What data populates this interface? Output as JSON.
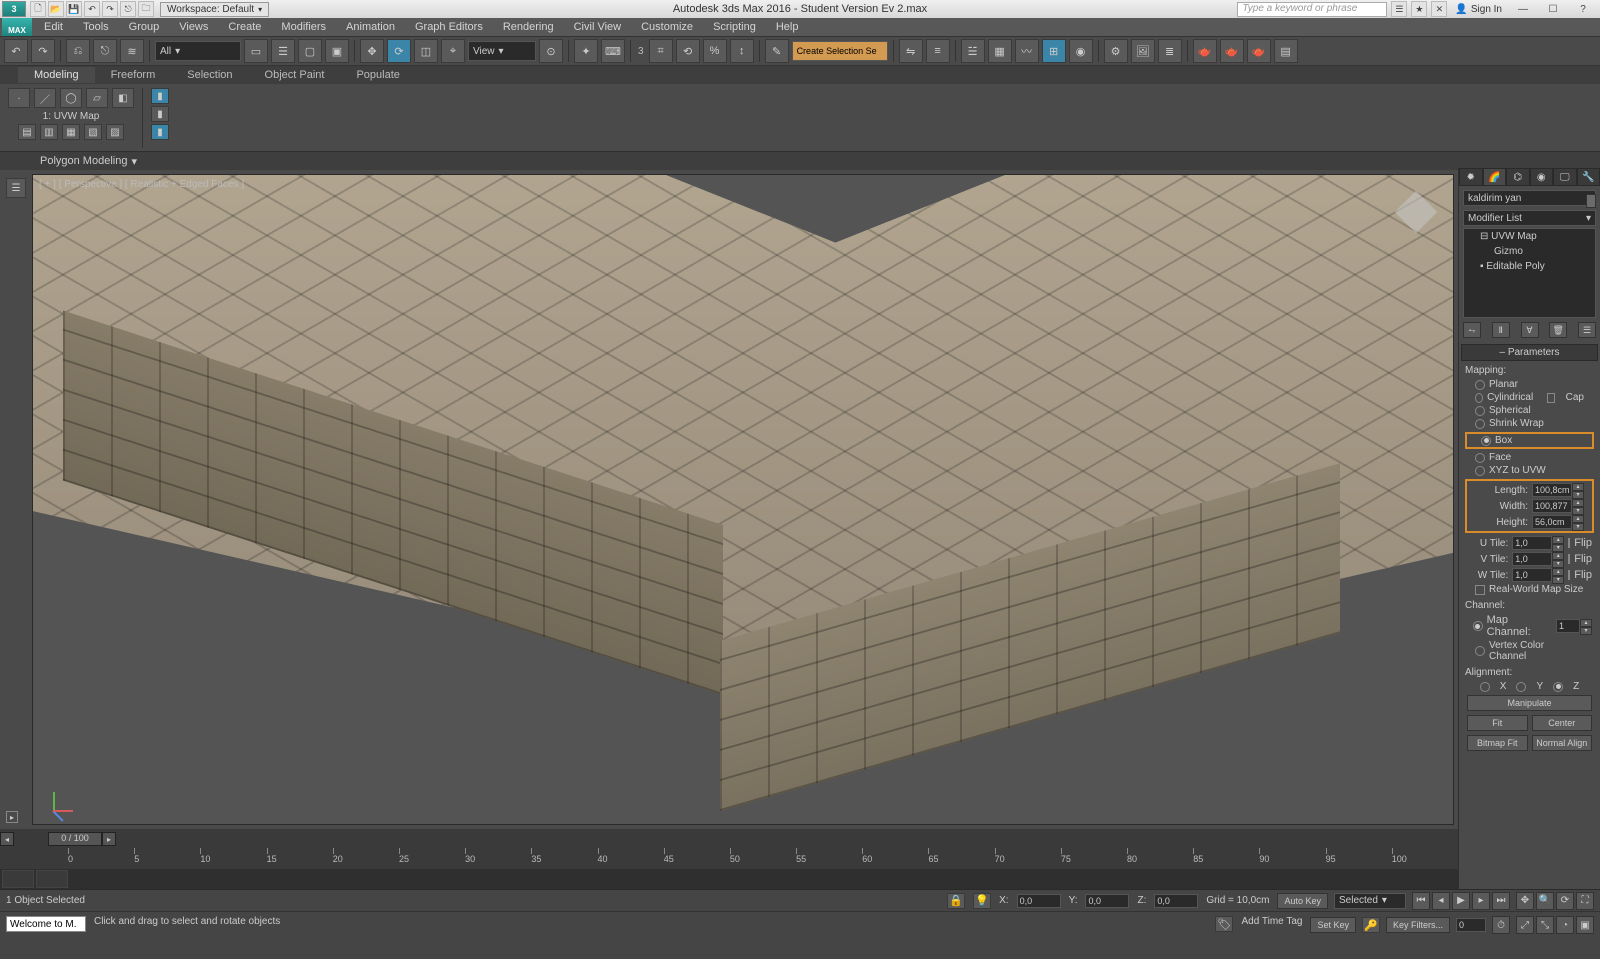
{
  "title": "Autodesk 3ds Max 2016 - Student Version   Ev 2.max",
  "workspace": {
    "label": "Workspace: Default"
  },
  "search_placeholder": "Type a keyword or phrase",
  "signin": "Sign In",
  "menu": [
    "Edit",
    "Tools",
    "Group",
    "Views",
    "Create",
    "Modifiers",
    "Animation",
    "Graph Editors",
    "Rendering",
    "Civil View",
    "Customize",
    "Scripting",
    "Help"
  ],
  "maintool": {
    "sel_filter": "All",
    "refcoord": "View",
    "create_sel_set": "Create Selection Se"
  },
  "ribbon": {
    "tabs": [
      "Modeling",
      "Freeform",
      "Selection",
      "Object Paint",
      "Populate"
    ],
    "active": "Modeling",
    "uvw_label": "1: UVW Map",
    "poly_bar": "Polygon Modeling"
  },
  "viewport": {
    "label": "[ + ] [ Perspective ] [ Realistic + Edged Faces ]"
  },
  "cmd": {
    "object_name": "kaldirim yan",
    "modlist_label": "Modifier List",
    "stack": [
      "UVW Map",
      "Gizmo",
      "Editable Poly"
    ],
    "param_header": "Parameters",
    "mapping_label": "Mapping:",
    "mapping_opts": [
      "Planar",
      "Cylindrical",
      "Spherical",
      "Shrink Wrap",
      "Box",
      "Face",
      "XYZ to UVW"
    ],
    "cap_label": "Cap",
    "length_label": "Length:",
    "length_val": "100,8cm",
    "width_label": "Width:",
    "width_val": "100,877",
    "height_label": "Height:",
    "height_val": "56,0cm",
    "utile_label": "U Tile:",
    "utile_val": "1,0",
    "vtile_label": "V Tile:",
    "vtile_val": "1,0",
    "wtile_label": "W Tile:",
    "wtile_val": "1,0",
    "flip_label": "Flip",
    "realworld": "Real-World Map Size",
    "channel_label": "Channel:",
    "mapchannel_label": "Map Channel:",
    "mapchannel_val": "1",
    "vcc_label": "Vertex Color Channel",
    "align_label": "Alignment:",
    "axes": [
      "X",
      "Y",
      "Z"
    ],
    "manipulate": "Manipulate",
    "fit": "Fit",
    "center": "Center",
    "bitmapfit": "Bitmap Fit",
    "normalalign": "Normal Align"
  },
  "timeline": {
    "scrub": "0 / 100",
    "start": 0,
    "end": 100,
    "step": 5
  },
  "status": {
    "selected": "1 Object Selected",
    "x": "0,0",
    "y": "0,0",
    "z": "0,0",
    "grid": "Grid = 10,0cm",
    "addtag": "Add Time Tag",
    "autokey": "Auto Key",
    "setkey": "Set Key",
    "keyfilters": "Key Filters...",
    "selected_mode": "Selected",
    "welcome": "Welcome to M.",
    "prompt": "Click and drag to select and rotate objects",
    "x_lbl": "X:",
    "y_lbl": "Y:",
    "z_lbl": "Z:"
  }
}
